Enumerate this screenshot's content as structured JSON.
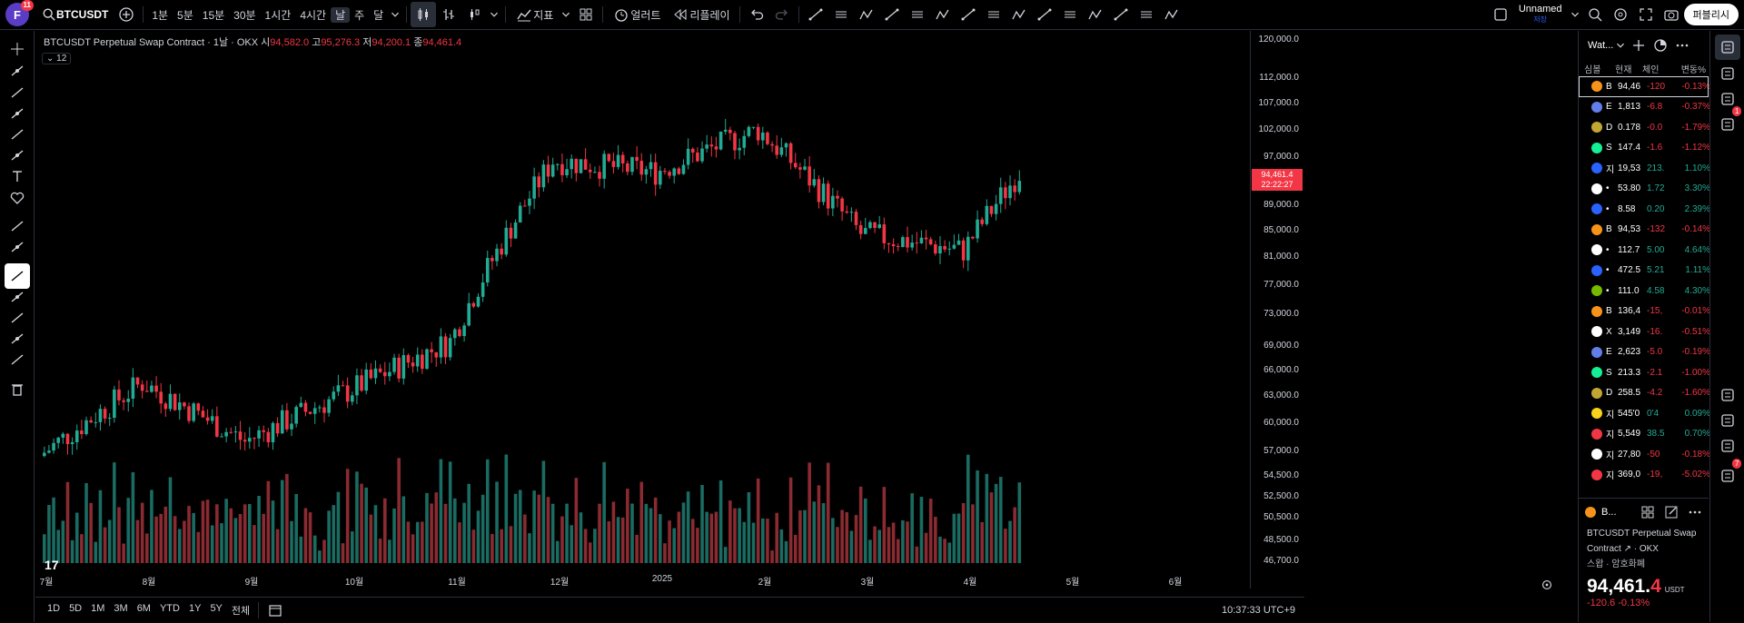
{
  "topbar": {
    "avatar_letter": "F",
    "avatar_badge": "11",
    "symbol": "BTCUSDT",
    "intervals": [
      "1분",
      "5분",
      "15분",
      "30분",
      "1시간",
      "4시간",
      "날",
      "주",
      "달"
    ],
    "active_interval": "날",
    "indicators_label": "지표",
    "alert_label": "얼러트",
    "replay_label": "리플레이",
    "layout_name": "Unnamed",
    "layout_sub": "저장",
    "publish_label": "퍼블리시"
  },
  "legend": {
    "title": "BTCUSDT Perpetual Swap Contract · 1날 · OKX",
    "open_label": "시",
    "open": "94,582.0",
    "high_label": "고",
    "high": "95,276.3",
    "low_label": "저",
    "low": "94,200.1",
    "close_label": "종",
    "close": "94,461.4",
    "indicator_count": "12"
  },
  "price_tag": {
    "price": "94,461.4",
    "countdown": "22:22:27"
  },
  "yaxis": {
    "ticks": [
      "120,000.0",
      "112,000.0",
      "107,000.0",
      "102,000.0",
      "97,000.0",
      "89,000.0",
      "85,000.0",
      "81,000.0",
      "77,000.0",
      "73,000.0",
      "69,000.0",
      "66,000.0",
      "63,000.0",
      "60,000.0",
      "57,000.0",
      "54,500.0",
      "52,500.0",
      "50,500.0",
      "48,500.0",
      "46,700.0"
    ]
  },
  "xaxis": {
    "ticks": [
      "7월",
      "8월",
      "9월",
      "10월",
      "11월",
      "12월",
      "2025",
      "2월",
      "3월",
      "4월",
      "5월",
      "6월"
    ]
  },
  "bottombar": {
    "ranges": [
      "1D",
      "5D",
      "1M",
      "3M",
      "6M",
      "YTD",
      "1Y",
      "5Y",
      "전체"
    ],
    "clock": "10:37:33 UTC+9"
  },
  "watchlist": {
    "title": "Wat...",
    "columns": [
      "심볼",
      "현재",
      "체인",
      "변동%"
    ],
    "rows": [
      {
        "sym": "B",
        "last": "94,46",
        "chg": "-120",
        "pct": "-0.13%",
        "dir": "down",
        "color": "#f7931a"
      },
      {
        "sym": "E",
        "last": "1,813",
        "chg": "-6.8",
        "pct": "-0.37%",
        "dir": "down",
        "color": "#627eea"
      },
      {
        "sym": "D",
        "last": "0.178",
        "chg": "-0.0",
        "pct": "-1.79%",
        "dir": "down",
        "color": "#c2a633"
      },
      {
        "sym": "S",
        "last": "147.4",
        "chg": "-1.6",
        "pct": "-1.12%",
        "dir": "down",
        "color": "#14f195"
      },
      {
        "sym": "지",
        "last": "19,53",
        "chg": "213.",
        "pct": "1.10%",
        "dir": "up",
        "color": "#2962ff"
      },
      {
        "sym": "•",
        "last": "53.80",
        "chg": "1.72",
        "pct": "3.30%",
        "dir": "up",
        "color": "#ffffff"
      },
      {
        "sym": "•",
        "last": "8.58",
        "chg": "0.20",
        "pct": "2.39%",
        "dir": "up",
        "color": "#2962ff"
      },
      {
        "sym": "B",
        "last": "94,53",
        "chg": "-132",
        "pct": "-0.14%",
        "dir": "down",
        "color": "#f7931a"
      },
      {
        "sym": "•",
        "last": "112.7",
        "chg": "5.00",
        "pct": "4.64%",
        "dir": "up",
        "color": "#ffffff"
      },
      {
        "sym": "•",
        "last": "472.5",
        "chg": "5.21",
        "pct": "1.11%",
        "dir": "up",
        "color": "#2962ff"
      },
      {
        "sym": "•",
        "last": "111.0",
        "chg": "4.58",
        "pct": "4.30%",
        "dir": "up",
        "color": "#76b900"
      },
      {
        "sym": "B",
        "last": "136,4",
        "chg": "-15,",
        "pct": "-0.01%",
        "dir": "down",
        "color": "#f7931a"
      },
      {
        "sym": "X",
        "last": "3,149",
        "chg": "-16.",
        "pct": "-0.51%",
        "dir": "down",
        "color": "#ffffff"
      },
      {
        "sym": "E",
        "last": "2,623",
        "chg": "-5.0",
        "pct": "-0.19%",
        "dir": "down",
        "color": "#627eea"
      },
      {
        "sym": "S",
        "last": "213.3",
        "chg": "-2.1",
        "pct": "-1.00%",
        "dir": "down",
        "color": "#14f195"
      },
      {
        "sym": "D",
        "last": "258.5",
        "chg": "-4.2",
        "pct": "-1.60%",
        "dir": "down",
        "color": "#c2a633"
      },
      {
        "sym": "지",
        "last": "545'0",
        "chg": "0'4",
        "pct": "0.09%",
        "dir": "up",
        "color": "#f7d21a"
      },
      {
        "sym": "지",
        "last": "5,549",
        "chg": "38.5",
        "pct": "0.70%",
        "dir": "up",
        "color": "#f23645"
      },
      {
        "sym": "지",
        "last": "27,80",
        "chg": "-50",
        "pct": "-0.18%",
        "dir": "down",
        "color": "#ffffff"
      },
      {
        "sym": "지",
        "last": "369,0",
        "chg": "-19,",
        "pct": "-5.02%",
        "dir": "down",
        "color": "#f23645"
      }
    ]
  },
  "detail": {
    "short": "B...",
    "name": "BTCUSDT Perpetual Swap",
    "name2": "Contract",
    "exchange": "OKX",
    "category": "스왑 · 암호화폐",
    "price": "94,461.",
    "price_last": "4",
    "currency": "USDT",
    "change": "-120.6",
    "change_pct": "-0.13%"
  },
  "rightbar": {
    "badge_alerts": "1",
    "badge_notifications": "7"
  },
  "chart_data": {
    "type": "candlestick",
    "x_ticks": [
      "7월",
      "8월",
      "9월",
      "10월",
      "11월",
      "12월",
      "2025",
      "2월",
      "3월",
      "4월",
      "5월",
      "6월"
    ],
    "ylim": [
      46700,
      120000
    ],
    "y_scale": "log",
    "monthly_path": [
      {
        "month": "7월",
        "close": 56500
      },
      {
        "month": "8월",
        "close": 64500
      },
      {
        "month": "9월",
        "close": 58000
      },
      {
        "month": "10월",
        "close": 63500
      },
      {
        "month": "11월",
        "close": 69500
      },
      {
        "month": "12월",
        "close": 96500
      },
      {
        "month": "2025",
        "close": 94500
      },
      {
        "month": "2월",
        "close": 102000
      },
      {
        "month": "3월",
        "close": 84500
      },
      {
        "month": "4월",
        "close": 82000
      },
      {
        "month": "5월",
        "close": 94461
      }
    ],
    "last_close": 94461.4,
    "up_color": "#22ab94",
    "down_color": "#f23645"
  }
}
